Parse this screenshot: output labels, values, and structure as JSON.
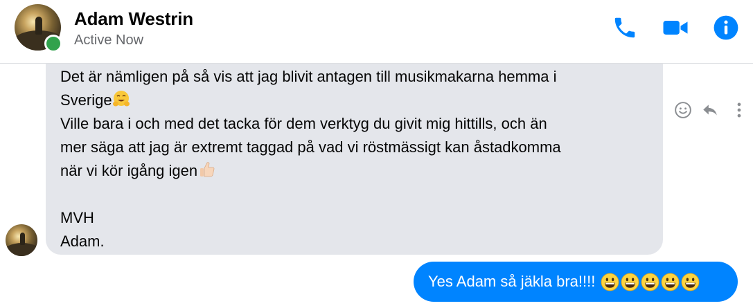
{
  "header": {
    "contact_name": "Adam Westrin",
    "status": "Active Now",
    "actions": [
      {
        "name": "phone-icon"
      },
      {
        "name": "video-camera-icon"
      },
      {
        "name": "info-icon"
      }
    ]
  },
  "colors": {
    "accent": "#0084ff",
    "incoming_bubble": "#e4e6eb",
    "presence": "#31a24c",
    "muted_text": "#65676b"
  },
  "incoming_message": {
    "lines": [
      "Det är nämligen på så vis att jag blivit antagen till musikmakarna hemma i",
      "Sverige",
      "Ville bara i och med det tacka för dem verktyg du givit mig hittills, och än",
      "mer säga att jag är extremt taggad på vad vi röstmässigt kan åstadkomma",
      "när vi kör igång igen",
      "MVH",
      "Adam."
    ],
    "emojis": [
      "hugging-face-emoji",
      "thumbs-up-emoji"
    ]
  },
  "message_actions": [
    "react-smiley-icon",
    "reply-icon",
    "more-options-icon"
  ],
  "outgoing_message": {
    "text": "Yes Adam så jäkla bra!!!!",
    "emoji_count": 5,
    "emoji": "grinning-face-emoji"
  }
}
